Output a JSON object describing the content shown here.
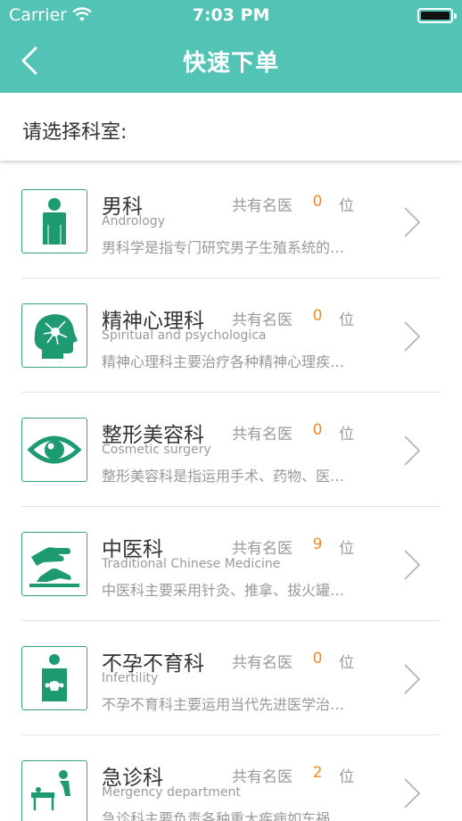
{
  "status_bar": {
    "carrier": "Carrier",
    "time": "7:03 PM"
  },
  "nav": {
    "title": "快速下单"
  },
  "section": {
    "prompt": "请选择科室:"
  },
  "colors": {
    "header": "#52c3b5",
    "icon_green": "#1e9a73",
    "count": "#f08a2c"
  },
  "departments": [
    {
      "name": "男科",
      "en": "Andrology",
      "count_label": "共有名医",
      "count": "0",
      "unit": "位",
      "desc": "男科学是指专门研究男子生殖系统的…",
      "icon": "male-body-icon"
    },
    {
      "name": "精神心理科",
      "en": "Spiritual and  psychologica",
      "count_label": "共有名医",
      "count": "0",
      "unit": "位",
      "desc": "精神心理科主要治疗各种精神心理疾…",
      "icon": "head-neuron-icon"
    },
    {
      "name": "整形美容科",
      "en": "Cosmetic surgery",
      "count_label": "共有名医",
      "count": "0",
      "unit": "位",
      "desc": "整形美容科是指运用手术、药物、医…",
      "icon": "eye-icon"
    },
    {
      "name": "中医科",
      "en": "Traditional Chinese Medicine",
      "count_label": "共有名医",
      "count": "9",
      "unit": "位",
      "desc": "中医科主要采用针灸、推拿、拔火罐…",
      "icon": "hands-pulse-icon"
    },
    {
      "name": "不孕不育科",
      "en": "Infertility",
      "count_label": "共有名医",
      "count": "0",
      "unit": "位",
      "desc": "不孕不育科主要运用当代先进医学治…",
      "icon": "reproductive-body-icon"
    },
    {
      "name": "急诊科",
      "en": "Mergency department",
      "count_label": "共有名医",
      "count": "2",
      "unit": "位",
      "desc": "急诊科主要负责各种重大疾病如车祸…",
      "icon": "emergency-stretcher-icon"
    }
  ]
}
